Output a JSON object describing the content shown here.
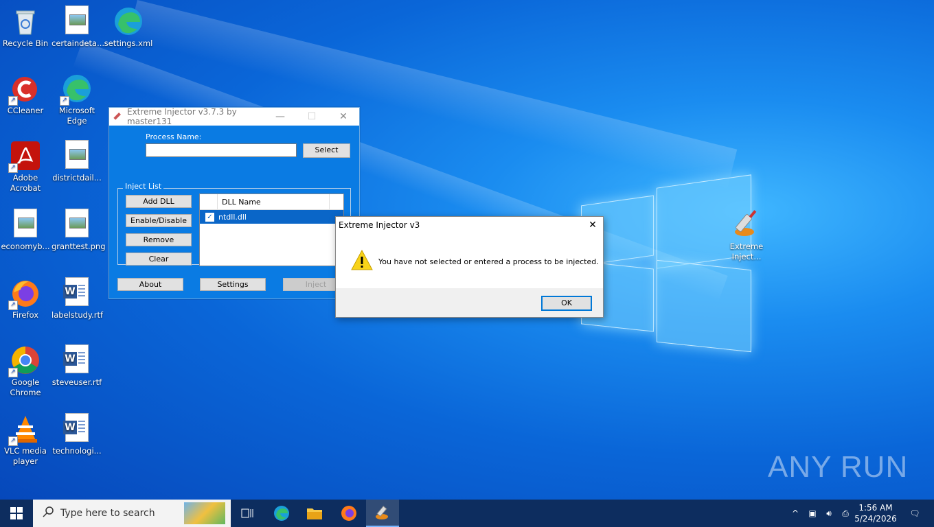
{
  "desktop_icons": [
    {
      "label": "Recycle Bin"
    },
    {
      "label": "certaindeta..."
    },
    {
      "label": "settings.xml"
    },
    {
      "label": "CCleaner"
    },
    {
      "label": "Microsoft Edge"
    },
    {
      "label": "Adobe Acrobat"
    },
    {
      "label": "districtdail..."
    },
    {
      "label": "economyb..."
    },
    {
      "label": "granttest.png"
    },
    {
      "label": "Firefox"
    },
    {
      "label": "labelstudy.rtf"
    },
    {
      "label": "Google Chrome"
    },
    {
      "label": "steveuser.rtf"
    },
    {
      "label": "VLC media player"
    },
    {
      "label": "technologi..."
    },
    {
      "label": "Extreme Inject..."
    }
  ],
  "injector": {
    "title": "Extreme Injector v3.7.3 by master131",
    "process_label": "Process Name:",
    "process_value": "",
    "select_label": "Select",
    "inject_list_label": "Inject List",
    "add_dll": "Add DLL",
    "enable_disable": "Enable/Disable",
    "remove": "Remove",
    "clear": "Clear",
    "column_dll_name": "DLL Name",
    "dlls": [
      {
        "name": "ntdll.dll",
        "checked": true
      }
    ],
    "about": "About",
    "settings": "Settings",
    "inject": "Inject"
  },
  "dialog": {
    "title": "Extreme Injector v3",
    "message": "You have not selected or entered a process to be injected.",
    "ok": "OK"
  },
  "taskbar": {
    "search_placeholder": "Type here to search",
    "time": "1:56 AM",
    "date": "5/24/2026"
  },
  "watermark": "ANY RUN"
}
